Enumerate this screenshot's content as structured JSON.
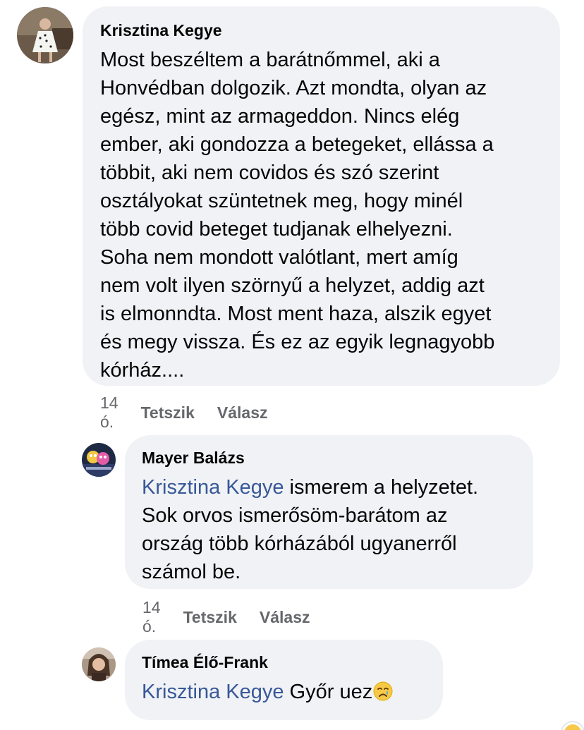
{
  "comments": [
    {
      "author": "Krisztina Kegye",
      "lines": [
        "Most beszéltem a barátnőmmel, aki a",
        "Honvédban dolgozik. Azt mondta, olyan az",
        "egész, mint az armageddon. Nincs elég",
        "ember, aki gondozza a betegeket, ellássa a",
        "többit, aki nem covidos és szó szerint",
        "osztályokat szüntetnek meg, hogy minél",
        "több covid beteget tudjanak elhelyezni.",
        "Soha nem mondott valótlant, mert amíg",
        "nem volt ilyen szörnyű a helyzet, addig azt",
        "is elmonndta. Most ment haza, alszik egyet",
        "és megy vissza.  És ez az egyik legnagyobb",
        "kórház...."
      ],
      "time": "14 ó.",
      "like_label": "Tetszik",
      "reply_label": "Válasz"
    },
    {
      "author": "Mayer Balázs",
      "mention": "Krisztina Kegye",
      "first_line_rest": " ismerem a helyzetet.",
      "lines": [
        "Sok orvos ismerősöm-barátom az",
        "ország több kórházából ugyanerről",
        "számol be."
      ],
      "time": "14 ó.",
      "like_label": "Tetszik",
      "reply_label": "Válasz"
    },
    {
      "author": "Tímea Élő-Frank",
      "mention": "Krisztina Kegye",
      "text": " Győr uez",
      "emoji": "crying-face-emoji"
    }
  ],
  "colors": {
    "bubble": "#f0f2f5",
    "mention": "#385898",
    "meta": "#65676b",
    "text": "#050505"
  }
}
